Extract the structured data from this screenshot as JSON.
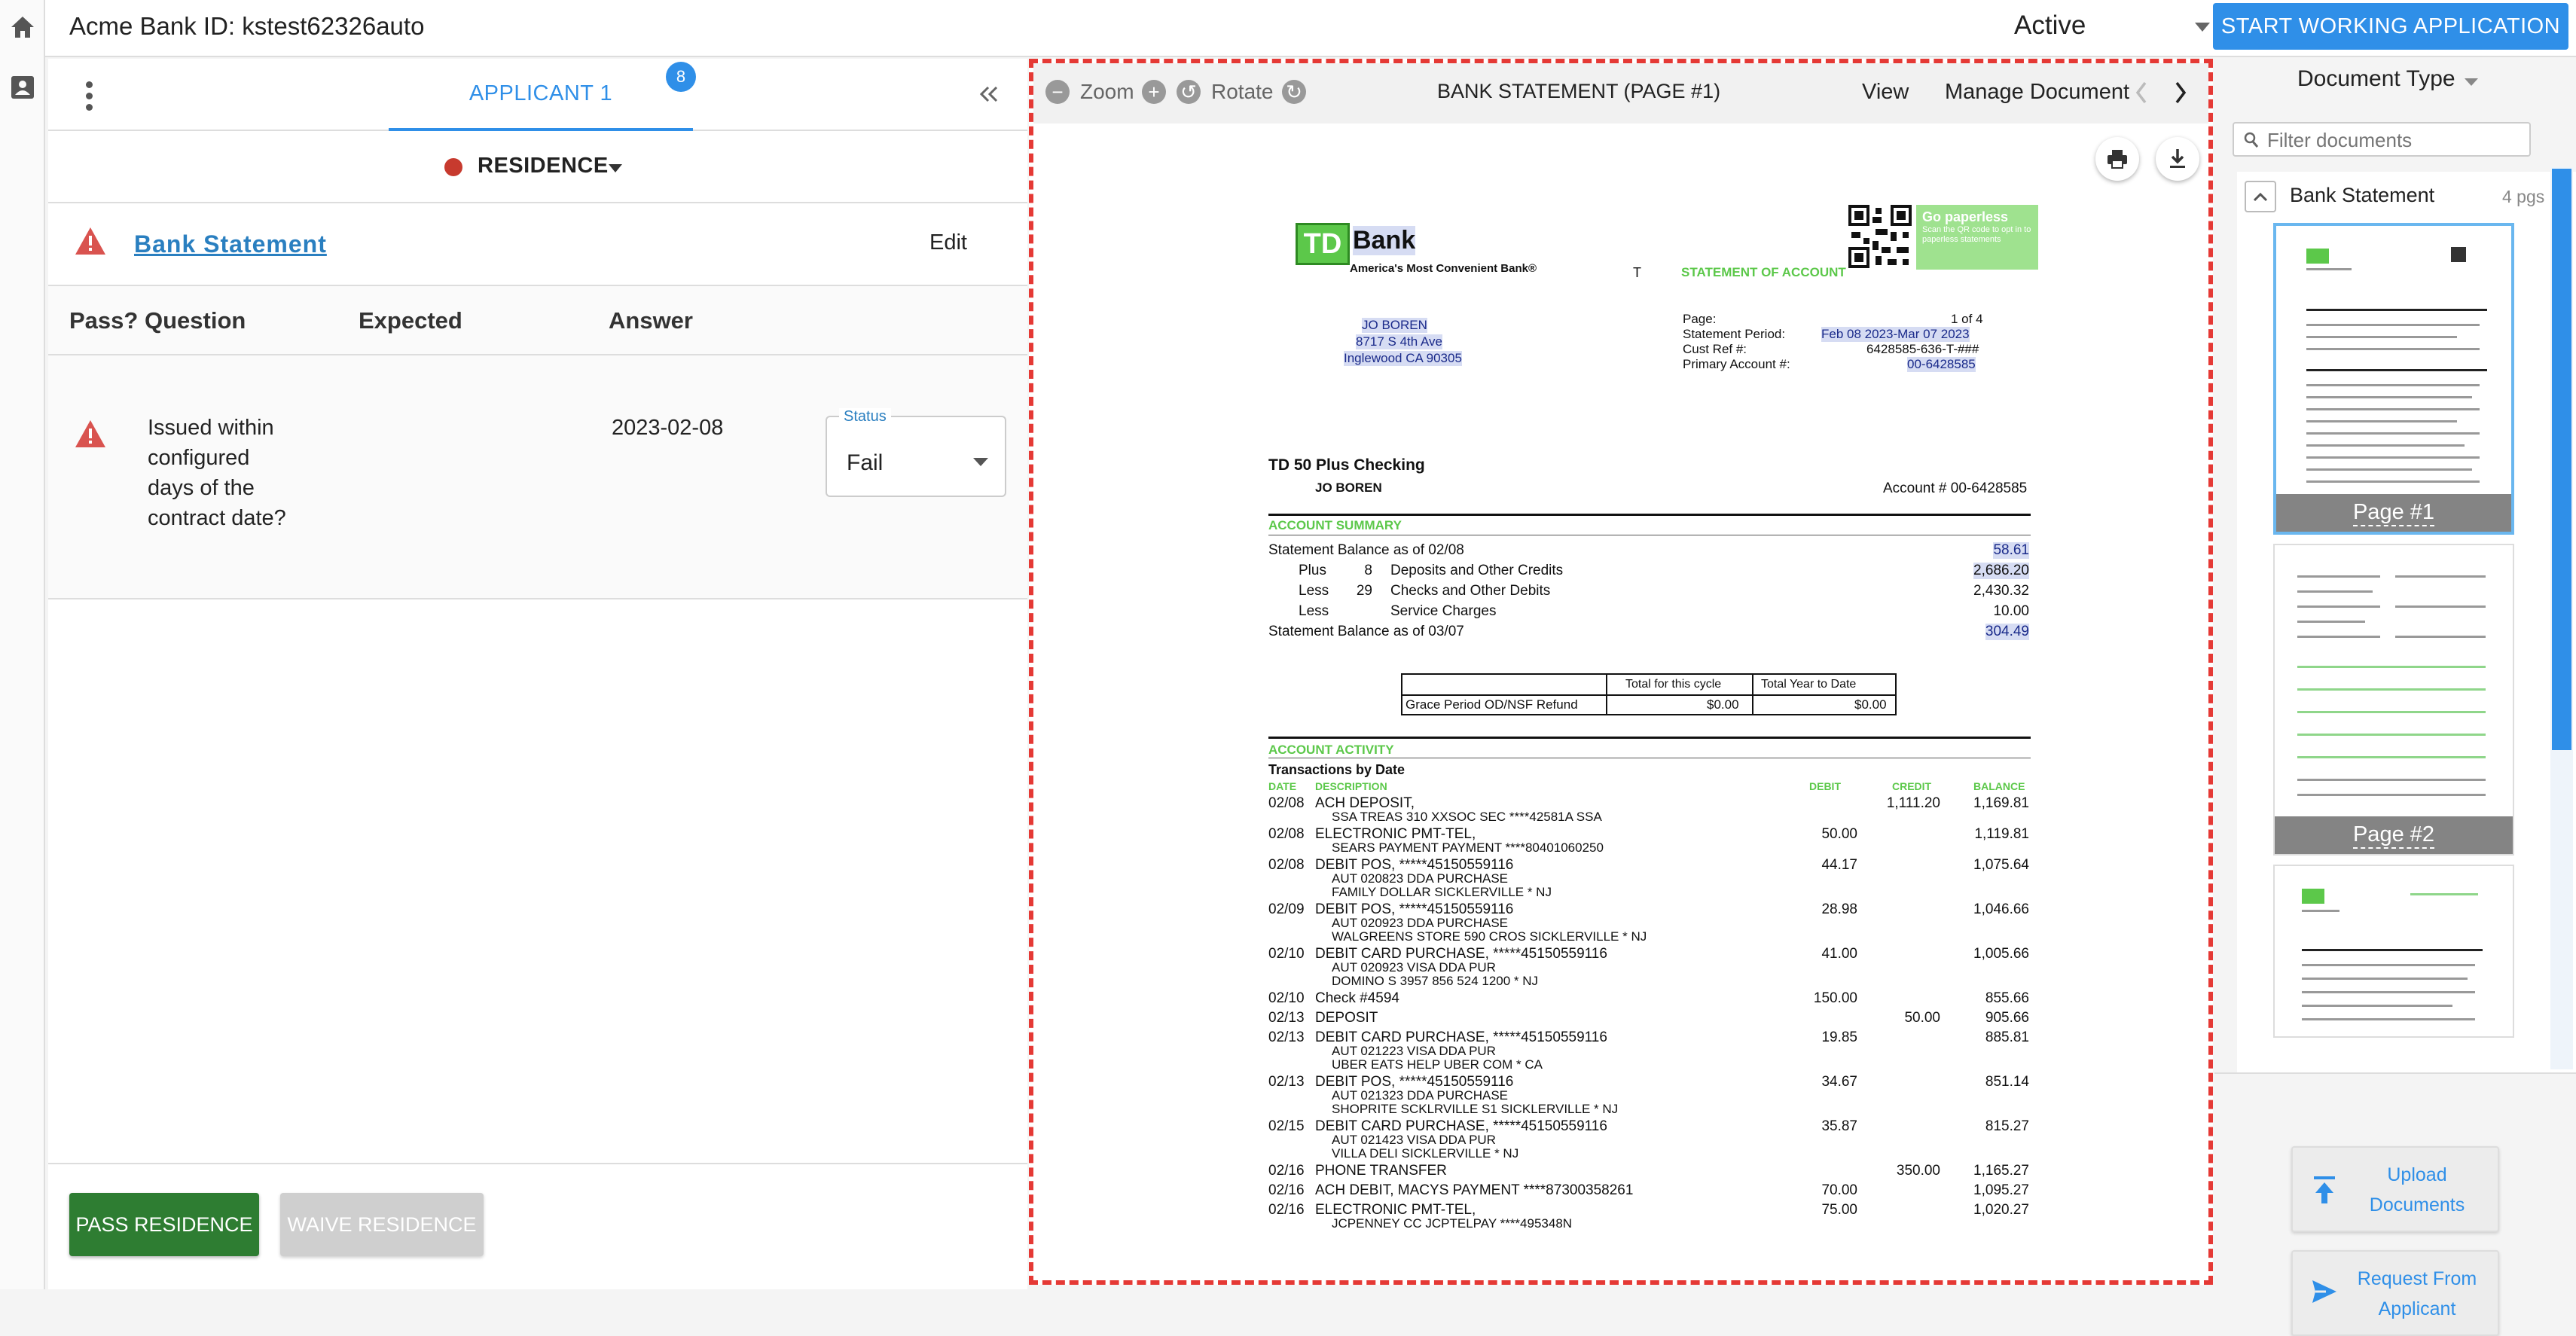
{
  "topbar": {
    "bank_id_label": "Acme Bank ID:  kstest62326auto",
    "status_value": "Active",
    "start_button": "START WORKING APPLICATION"
  },
  "applicant_panel": {
    "tab_label": "APPLICANT 1",
    "tab_badge": "8",
    "section": "RESIDENCE",
    "document_link": "Bank Statement",
    "edit_label": "Edit",
    "columns": {
      "pass": "Pass?",
      "question": "Question",
      "expected": "Expected",
      "answer": "Answer"
    },
    "question_row": {
      "question": "Issued within configured days of the contract date?",
      "expected": "",
      "answer": "2023-02-08",
      "status_legend": "Status",
      "status_value": "Fail"
    },
    "pass_button": "PASS RESIDENCE",
    "waive_button": "WAIVE RESIDENCE"
  },
  "viewer": {
    "zoom_label": "Zoom",
    "rotate_label": "Rotate",
    "title": "BANK STATEMENT (PAGE #1)",
    "view_label": "View",
    "manage_label": "Manage Document"
  },
  "statement": {
    "logo_td": "TD",
    "logo_bank": "Bank",
    "tagline": "America's Most Convenient Bank®",
    "paperless_title": "Go paperless",
    "paperless_text": "Scan the QR code to opt in to paperless statements",
    "stmt_of_account": "STATEMENT OF ACCOUNT",
    "addr_name": "JO BOREN",
    "addr_street": "8717 S 4th Ave",
    "addr_city": "Inglewood CA 90305",
    "lbl_page": "Page:",
    "val_page": "1 of 4",
    "lbl_period": "Statement Period:",
    "val_period": "Feb 08 2023-Mar 07 2023",
    "lbl_cust": "Cust Ref #:",
    "val_cust": "6428585-636-T-###",
    "lbl_primary": "Primary Account #:",
    "val_primary": "00-6428585",
    "product": "TD 50 Plus Checking",
    "holder": "JO BOREN",
    "account_no": "Account # 00-6428585",
    "summary_title": "ACCOUNT SUMMARY",
    "summary": [
      {
        "a": "Statement Balance as of 02/08",
        "b": "",
        "c": "",
        "v": "58.61"
      },
      {
        "a": "Plus",
        "b": "8",
        "c": "Deposits and Other Credits",
        "v": "2,686.20"
      },
      {
        "a": "Less",
        "b": "29",
        "c": "Checks and Other Debits",
        "v": "2,430.32"
      },
      {
        "a": "Less",
        "b": "",
        "c": "Service Charges",
        "v": "10.00"
      },
      {
        "a": "Statement Balance as of 03/07",
        "b": "",
        "c": "",
        "v": "304.49"
      }
    ],
    "grace_h1": "Total for this cycle",
    "grace_h2": "Total Year to Date",
    "grace_label": "Grace Period OD/NSF Refund",
    "grace_v1": "$0.00",
    "grace_v2": "$0.00",
    "activity_title": "ACCOUNT ACTIVITY",
    "by_date": "Transactions by Date",
    "col_date": "DATE",
    "col_desc": "DESCRIPTION",
    "col_debit": "DEBIT",
    "col_credit": "CREDIT",
    "col_balance": "BALANCE",
    "transactions": [
      {
        "date": "02/08",
        "desc": "ACH DEPOSIT,",
        "sub": [
          "SSA  TREAS 310 XXSOC SEC ****42581A  SSA"
        ],
        "debit": "",
        "credit": "1,111.20",
        "balance": "1,169.81"
      },
      {
        "date": "02/08",
        "desc": "ELECTRONIC PMT-TEL,",
        "sub": [
          "SEARS PAYMENT PAYMENT ****80401060250"
        ],
        "debit": "50.00",
        "credit": "",
        "balance": "1,119.81"
      },
      {
        "date": "02/08",
        "desc": "DEBIT POS, *****45150559116",
        "sub": [
          "AUT 020823 DDA PURCHASE",
          "FAMILY DOLLAR              SICKLERVILLE  * NJ"
        ],
        "debit": "44.17",
        "credit": "",
        "balance": "1,075.64"
      },
      {
        "date": "02/09",
        "desc": "DEBIT POS, *****45150559116",
        "sub": [
          "AUT 020923 DDA PURCHASE",
          "WALGREENS STORE 590 CROS    SICKLERVILLE  * NJ"
        ],
        "debit": "28.98",
        "credit": "",
        "balance": "1,046.66"
      },
      {
        "date": "02/10",
        "desc": "DEBIT CARD PURCHASE, *****45150559116",
        "sub": [
          "AUT 020923 VISA DDA PUR",
          "DOMINO S 3957              856 524 1200  * NJ"
        ],
        "debit": "41.00",
        "credit": "",
        "balance": "1,005.66"
      },
      {
        "date": "02/10",
        "desc": "Check #4594",
        "sub": [],
        "debit": "150.00",
        "credit": "",
        "balance": "855.66"
      },
      {
        "date": "02/13",
        "desc": "DEPOSIT",
        "sub": [],
        "debit": "",
        "credit": "50.00",
        "balance": "905.66"
      },
      {
        "date": "02/13",
        "desc": "DEBIT CARD PURCHASE, *****45150559116",
        "sub": [
          "AUT 021223 VISA DDA PUR",
          "UBER   EATS               HELP UBER COM * CA"
        ],
        "debit": "19.85",
        "credit": "",
        "balance": "885.81"
      },
      {
        "date": "02/13",
        "desc": "DEBIT POS, *****45150559116",
        "sub": [
          "AUT 021323 DDA PURCHASE",
          "SHOPRITE SCKLRVILLE S1     SICKLERVILLE  * NJ"
        ],
        "debit": "34.67",
        "credit": "",
        "balance": "851.14"
      },
      {
        "date": "02/15",
        "desc": "DEBIT CARD PURCHASE, *****45150559116",
        "sub": [
          "AUT 021423 VISA DDA PUR",
          "VILLA DELI                 SICKLERVILLE  * NJ"
        ],
        "debit": "35.87",
        "credit": "",
        "balance": "815.27"
      },
      {
        "date": "02/16",
        "desc": "PHONE TRANSFER",
        "sub": [],
        "debit": "",
        "credit": "350.00",
        "balance": "1,165.27"
      },
      {
        "date": "02/16",
        "desc": "ACH DEBIT, MACYS PAYMENT ****87300358261",
        "sub": [],
        "debit": "70.00",
        "credit": "",
        "balance": "1,095.27"
      },
      {
        "date": "02/16",
        "desc": "ELECTRONIC PMT-TEL,",
        "sub": [
          "JCPENNEY CC JCPTELPAY ****495348N"
        ],
        "debit": "75.00",
        "credit": "",
        "balance": "1,020.27"
      }
    ]
  },
  "documents_panel": {
    "doc_type_label": "Document Type",
    "filter_placeholder": "Filter documents",
    "group_name": "Bank Statement",
    "group_count": "4 pgs",
    "thumbnails": [
      {
        "label": "Page #1",
        "selected": true
      },
      {
        "label": "Page #2",
        "selected": false
      },
      {
        "label": "",
        "selected": false
      }
    ],
    "upload_button": "Upload Documents",
    "request_button": "Request From Applicant"
  },
  "colors": {
    "accent": "#2f8fe8",
    "pass_green": "#2e7d32",
    "fail_red": "#c73a2e",
    "viewer_border": "#e53935",
    "td_green": "#5cc84a"
  }
}
